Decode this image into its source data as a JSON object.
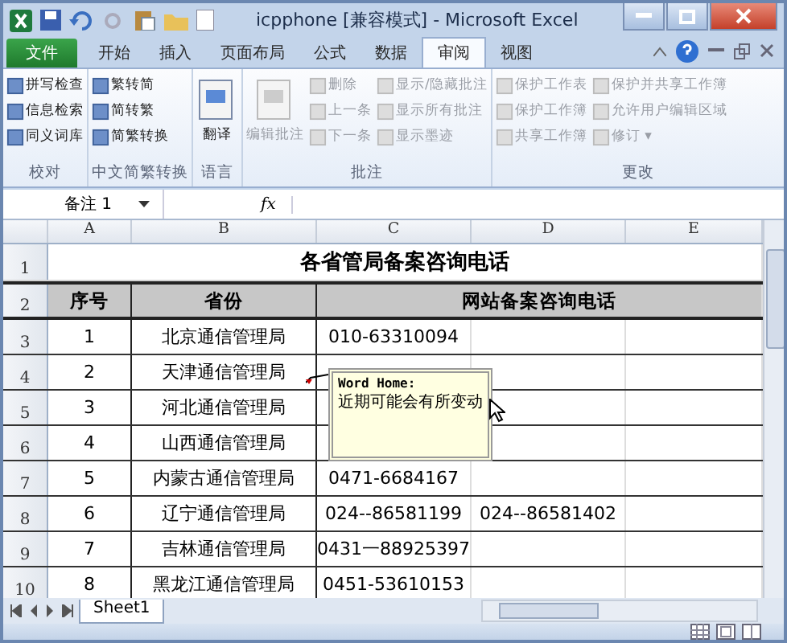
{
  "window": {
    "title": "icpphone  [兼容模式]  -  Microsoft Excel"
  },
  "tabs": [
    {
      "label": "文件",
      "kind": "file",
      "selected": true
    },
    {
      "label": "开始",
      "kind": "tab",
      "selected": false
    },
    {
      "label": "插入",
      "kind": "tab",
      "selected": false
    },
    {
      "label": "页面布局",
      "kind": "tab",
      "selected": false
    },
    {
      "label": "公式",
      "kind": "tab",
      "selected": false
    },
    {
      "label": "数据",
      "kind": "tab",
      "selected": false
    },
    {
      "label": "审阅",
      "kind": "tab",
      "selected": true
    },
    {
      "label": "视图",
      "kind": "tab",
      "selected": false
    }
  ],
  "ribbon_groups": [
    {
      "label": "校对",
      "columns": [
        [
          {
            "label": "拼写检查",
            "kind": "small",
            "disabled": false
          },
          {
            "label": "信息检索",
            "kind": "small",
            "disabled": false
          },
          {
            "label": "同义词库",
            "kind": "small",
            "disabled": false
          }
        ]
      ]
    },
    {
      "label": "中文简繁转换",
      "columns": [
        [
          {
            "label": "繁转简",
            "kind": "small",
            "disabled": false
          },
          {
            "label": "简转繁",
            "kind": "small",
            "disabled": false
          },
          {
            "label": "简繁转换",
            "kind": "small",
            "disabled": false
          }
        ]
      ]
    },
    {
      "label": "语言",
      "columns": [
        [
          {
            "label": "翻译",
            "kind": "large",
            "disabled": false
          }
        ]
      ]
    },
    {
      "label": "批注",
      "columns": [
        [
          {
            "label": "编辑批注",
            "kind": "large",
            "disabled": true
          }
        ],
        [
          {
            "label": "删除",
            "kind": "small",
            "disabled": true
          },
          {
            "label": "上一条",
            "kind": "small",
            "disabled": true
          },
          {
            "label": "下一条",
            "kind": "small",
            "disabled": true
          }
        ],
        [
          {
            "label": "显示/隐藏批注",
            "kind": "small",
            "disabled": true
          },
          {
            "label": "显示所有批注",
            "kind": "small",
            "disabled": true
          },
          {
            "label": "显示墨迹",
            "kind": "small",
            "disabled": true
          }
        ]
      ]
    },
    {
      "label": "更改",
      "columns": [
        [
          {
            "label": "保护工作表",
            "kind": "small",
            "disabled": true
          },
          {
            "label": "保护工作簿",
            "kind": "small",
            "disabled": true
          },
          {
            "label": "共享工作簿",
            "kind": "small",
            "disabled": true
          }
        ],
        [
          {
            "label": "保护并共享工作簿",
            "kind": "small",
            "disabled": true
          },
          {
            "label": "允许用户编辑区域",
            "kind": "small",
            "disabled": true
          },
          {
            "label": "修订 ▾",
            "kind": "small",
            "disabled": true
          }
        ]
      ]
    }
  ],
  "formula_bar": {
    "name_box": "备注 1",
    "fx_label": "fx"
  },
  "sheet": {
    "columns": [
      "A",
      "B",
      "C",
      "D",
      "E"
    ],
    "rows": [
      {
        "number": "1",
        "kind": "title",
        "title": "各省管局备案咨询电话"
      },
      {
        "number": "2",
        "kind": "header",
        "no": "序号",
        "province": "省份",
        "phone": "网站备案咨询电话"
      },
      {
        "number": "3",
        "kind": "data",
        "no": "1",
        "province": "北京通信管理局",
        "phone_1": "010-63310094"
      },
      {
        "number": "4",
        "kind": "data",
        "no": "2",
        "province": "天津通信管理局"
      },
      {
        "number": "5",
        "kind": "data",
        "no": "3",
        "province": "河北通信管理局"
      },
      {
        "number": "6",
        "kind": "data",
        "no": "4",
        "province": "山西通信管理局"
      },
      {
        "number": "7",
        "kind": "data",
        "no": "5",
        "province": "内蒙古通信管理局",
        "phone_1": "0471-6684167"
      },
      {
        "number": "8",
        "kind": "data",
        "no": "6",
        "province": "辽宁通信管理局",
        "phone_1": "024--86581199",
        "phone_2": "024--86581402"
      },
      {
        "number": "9",
        "kind": "data",
        "no": "7",
        "province": "吉林通信管理局",
        "phone_1": "0431一88925397"
      },
      {
        "number": "10",
        "kind": "data",
        "no": "8",
        "province": "黑龙江通信管理局",
        "phone_1": "0451-53610153"
      }
    ]
  },
  "comment": {
    "author": "Word Home:",
    "text": "近期可能会有所变动"
  },
  "sheet_tabs": [
    {
      "label": "Sheet1",
      "selected": true
    }
  ]
}
